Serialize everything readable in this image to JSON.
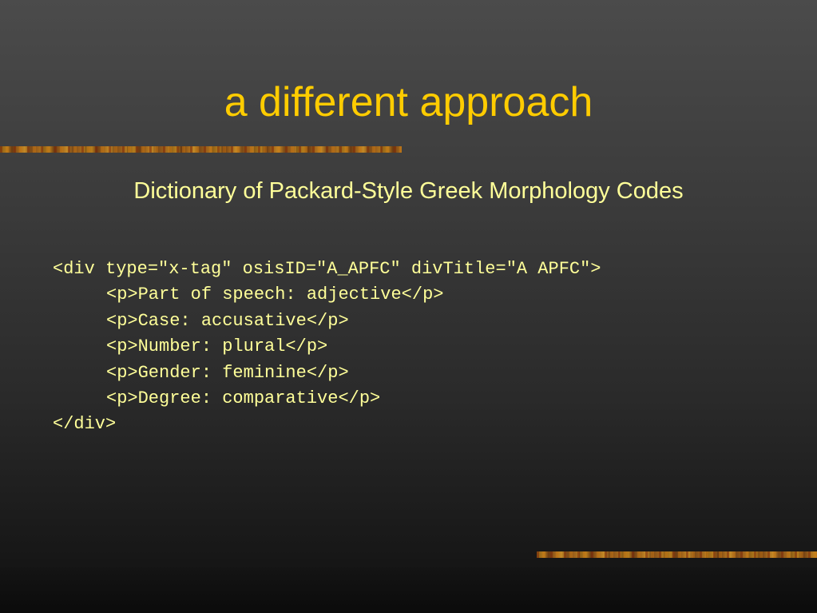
{
  "slide": {
    "title": "a different approach",
    "subtitle": "Dictionary of Packard-Style Greek Morphology Codes",
    "code_lines": [
      "<div type=\"x-tag\" osisID=\"A_APFC\" divTitle=\"A APFC\">",
      "<p>Part of speech: adjective</p>",
      "<p>Case: accusative</p>",
      "<p>Number: plural</p>",
      "<p>Gender: feminine</p>",
      "<p>Degree: comparative</p>",
      "</div>"
    ]
  },
  "colors": {
    "title": "#ffcc00",
    "text": "#ffff99",
    "background": "#3a3a3a",
    "accent_bar": "#b77d1c"
  }
}
